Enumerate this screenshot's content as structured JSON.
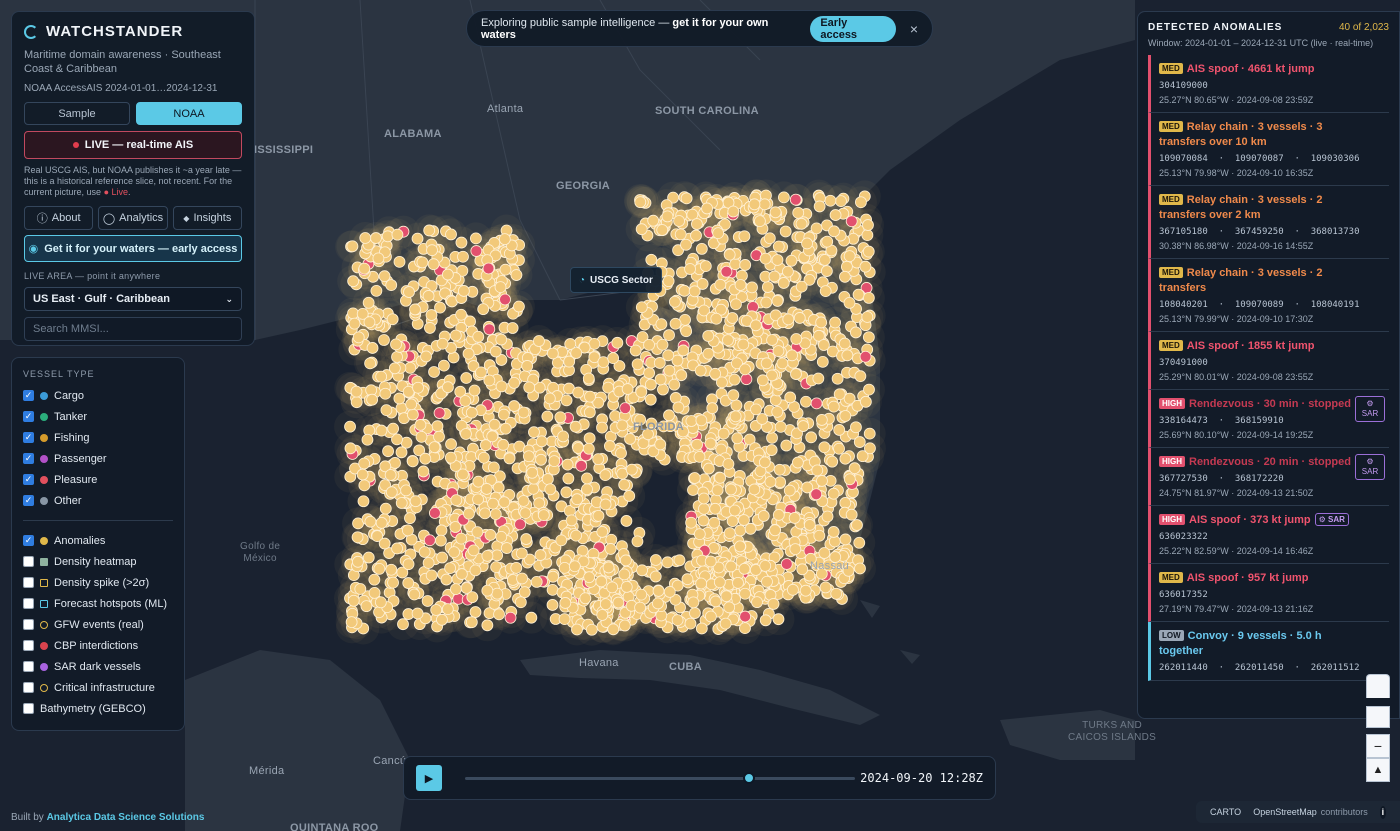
{
  "map_labels": {
    "alabama": "ALABAMA",
    "mississippi": "ISSISSIPPI",
    "atlanta": "Atlanta",
    "south_carolina": "SOUTH CAROLINA",
    "georgia": "GEORGIA",
    "florida": "FLORIDA",
    "golfo": "Golfo de\nMéxico",
    "havana": "Havana",
    "cuba": "CUBA",
    "nassau": "Nassau",
    "merida": "Mérida",
    "cancun": "Cancú",
    "turks": "TURKS AND\nCAICOS ISLANDS",
    "quintana": "QUINTANA ROO"
  },
  "uscg_label": "USCG Sector",
  "sidebar": {
    "title": "WATCHSTANDER",
    "subtitle": "Maritime domain awareness · Southeast Coast & Caribbean",
    "source": "NOAA AccessAIS 2024-01-01…2024-12-31",
    "sample_label": "Sample",
    "noaa_label": "NOAA",
    "live_label": "LIVE — real-time AIS",
    "note_text": "Real USCG AIS, but NOAA publishes it ~a year late — this is a historical reference slice, not recent. For the current picture, use",
    "note_link": "Live",
    "about_label": "About",
    "analytics_label": "Analytics",
    "insights_label": "Insights",
    "access_label": "Get it for your waters — early access",
    "live_area_label": "LIVE AREA — point it anywhere",
    "region_value": "US East · Gulf · Caribbean",
    "search_placeholder": "Search MMSI..."
  },
  "layers": {
    "heading": "VESSEL TYPE",
    "vessel_types": [
      {
        "label": "Cargo",
        "color": "#3b9bd8",
        "checked": true
      },
      {
        "label": "Tanker",
        "color": "#2bae7c",
        "checked": true
      },
      {
        "label": "Fishing",
        "color": "#d59b2b",
        "checked": true
      },
      {
        "label": "Passenger",
        "color": "#b251c8",
        "checked": true
      },
      {
        "label": "Pleasure",
        "color": "#e2505e",
        "checked": true
      },
      {
        "label": "Other",
        "color": "#8896a5",
        "checked": true
      }
    ],
    "overlays": [
      {
        "label": "Anomalies",
        "checked": true,
        "swatch": "dot",
        "color": "#e0b84a"
      },
      {
        "label": "Density heatmap",
        "checked": false,
        "swatch": "square",
        "color": "#8fb3a0"
      },
      {
        "label": "Density spike (>2σ)",
        "checked": false,
        "swatch": "square-outline",
        "color": "#e0b84a"
      },
      {
        "label": "Forecast hotspots (ML)",
        "checked": false,
        "swatch": "square-outline",
        "color": "#5bc9e6"
      },
      {
        "label": "GFW events (real)",
        "checked": false,
        "swatch": "ring",
        "color": "#e0b84a"
      },
      {
        "label": "CBP interdictions",
        "checked": false,
        "swatch": "dot",
        "color": "#d9434e"
      },
      {
        "label": "SAR dark vessels",
        "checked": false,
        "swatch": "dot",
        "color": "#a863e0"
      },
      {
        "label": "Critical infrastructure",
        "checked": false,
        "swatch": "ring",
        "color": "#e0b84a"
      },
      {
        "label": "Bathymetry (GEBCO)",
        "checked": false,
        "swatch": "none",
        "color": ""
      }
    ]
  },
  "banner": {
    "text": "Exploring public sample intelligence —",
    "cta_text": "get it for your own waters",
    "button": "Early access",
    "close": "×"
  },
  "anomalies": {
    "heading": "DETECTED ANOMALIES",
    "count": "40 of 2,023",
    "window": "Window: 2024-01-01 – 2024-12-31 UTC (live · real-time)",
    "items": [
      {
        "level": "MED",
        "title": "AIS spoof · 4661 kt jump",
        "ids": "304109000",
        "loc": "25.27°N 80.65°W · 2024-09-08 23:59Z",
        "style": "red",
        "sar": ""
      },
      {
        "level": "MED",
        "title": "Relay chain · 3 vessels · 3 transfers over 10 km",
        "ids": "109070084  ·  109070087  ·  109030306",
        "loc": "25.13°N 79.98°W · 2024-09-10 16:35Z",
        "style": "orange",
        "sar": ""
      },
      {
        "level": "MED",
        "title": "Relay chain · 3 vessels · 2 transfers over 2 km",
        "ids": "367105180  ·  367459250  ·  368013730",
        "loc": "30.38°N 86.98°W · 2024-09-16 14:55Z",
        "style": "orange",
        "sar": ""
      },
      {
        "level": "MED",
        "title": "Relay chain · 3 vessels · 2 transfers",
        "ids": "108040201  ·  109070089  ·  108040191",
        "loc": "25.13°N 79.99°W · 2024-09-10 17:30Z",
        "style": "orange",
        "sar": ""
      },
      {
        "level": "MED",
        "title": "AIS spoof · 1855 kt jump",
        "ids": "370491000",
        "loc": "25.29°N 80.01°W · 2024-09-08 23:55Z",
        "style": "red",
        "sar": ""
      },
      {
        "level": "HIGH",
        "title": "Rendezvous · 30 min · stopped",
        "ids": "338164473  ·  368159910",
        "loc": "25.69°N 80.10°W · 2024-09-14 19:25Z",
        "style": "dim",
        "sar": "SAR"
      },
      {
        "level": "HIGH",
        "title": "Rendezvous · 20 min · stopped",
        "ids": "367727530  ·  368172220",
        "loc": "24.75°N 81.97°W · 2024-09-13 21:50Z",
        "style": "dim",
        "sar": "SAR"
      },
      {
        "level": "HIGH",
        "title": "AIS spoof · 373 kt jump",
        "ids": "636023322",
        "loc": "25.22°N 82.59°W · 2024-09-14 16:46Z",
        "style": "red",
        "sar_inline": "SAR"
      },
      {
        "level": "MED",
        "title": "AIS spoof · 957 kt jump",
        "ids": "636017352",
        "loc": "27.19°N 79.47°W · 2024-09-13 21:16Z",
        "style": "red",
        "sar": ""
      },
      {
        "level": "LOW",
        "title": "Convoy · 9 vessels · 5.0 h together",
        "ids": "262011440  ·  262011450  ·  262011512",
        "loc": "",
        "style": "blue",
        "sar": ""
      }
    ]
  },
  "timeline": {
    "timestamp": "2024-09-20 12:28Z",
    "progress": 0.713
  },
  "zoom": {
    "minus": "−",
    "compass": "▲"
  },
  "footer": {
    "prefix": "Built by",
    "link": "Analytica Data Science Solutions"
  },
  "attribution": {
    "carto": "CARTO",
    "osm": "OpenStreetMap",
    "contributors": "contributors",
    "info": "i"
  }
}
